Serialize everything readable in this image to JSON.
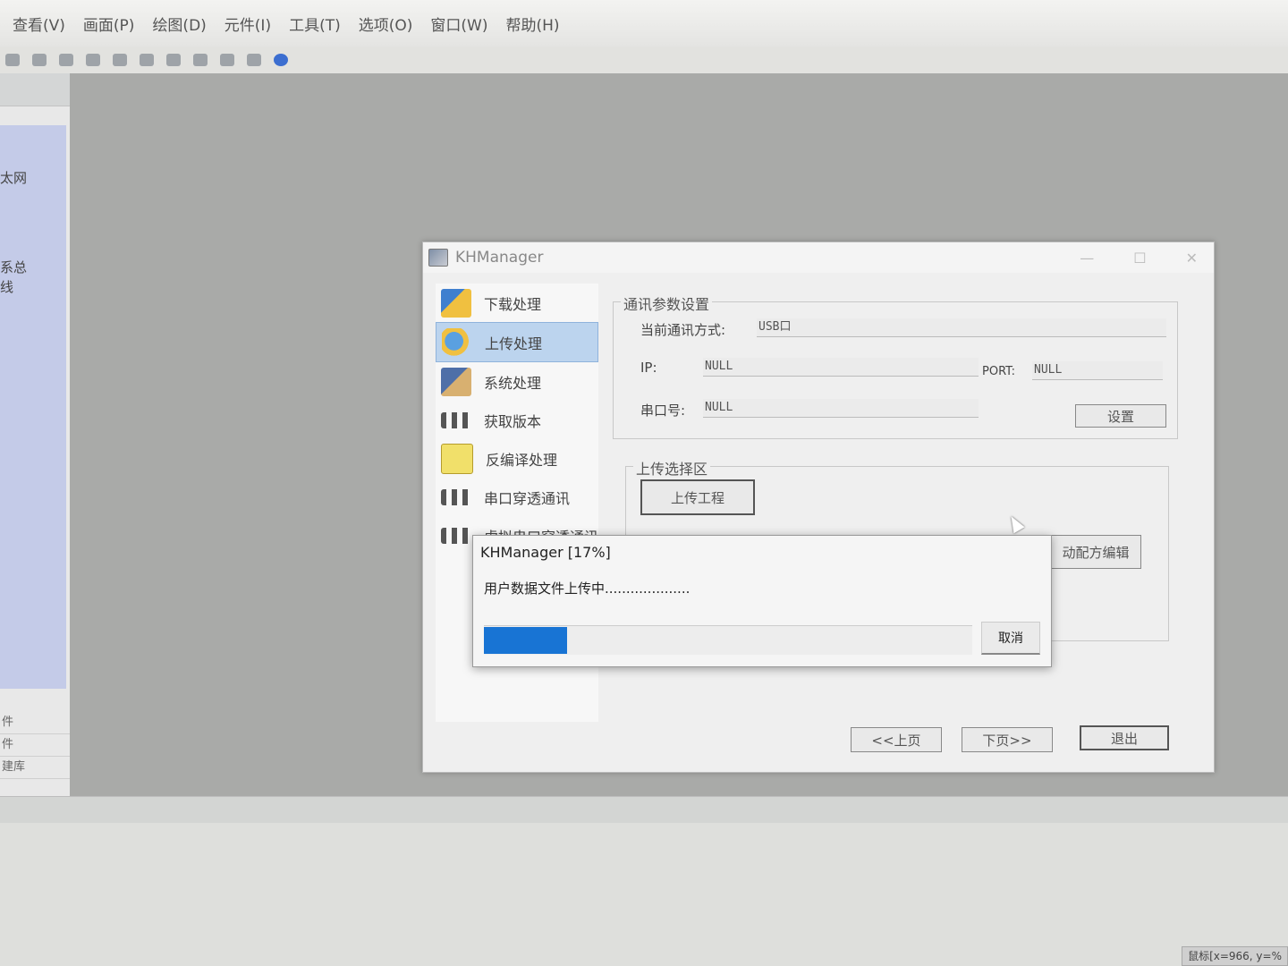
{
  "menubar": {
    "items": [
      "查看(V)",
      "画面(P)",
      "绘图(D)",
      "元件(I)",
      "工具(T)",
      "选项(O)",
      "窗口(W)",
      "帮助(H)"
    ]
  },
  "left_panel": {
    "text1": "太网",
    "text2": "系总",
    "text3": "线",
    "list": [
      "件",
      "件",
      "建库"
    ]
  },
  "status": {
    "coord": "鼠标[x=966, y=%"
  },
  "main_dialog": {
    "title": "KHManager",
    "nav": [
      {
        "label": "下载处理",
        "icon": "download-icon"
      },
      {
        "label": "上传处理",
        "icon": "upload-icon"
      },
      {
        "label": "系统处理",
        "icon": "system-icon"
      },
      {
        "label": "获取版本",
        "icon": "version-icon"
      },
      {
        "label": "反编译处理",
        "icon": "decompile-icon"
      },
      {
        "label": "串口穿透通讯",
        "icon": "serial-icon"
      },
      {
        "label": "虚拟串口穿透通讯",
        "icon": "virtual-serial-icon"
      }
    ],
    "comm": {
      "group_title": "通讯参数设置",
      "mode_label": "当前通讯方式:",
      "mode_value": "USB口",
      "ip_label": "IP:",
      "ip_value": "NULL",
      "port_label": "PORT:",
      "port_value": "NULL",
      "serial_label": "串口号:",
      "serial_value": "NULL",
      "settings_btn": "设置"
    },
    "upload": {
      "group_title": "上传选择区",
      "upload_project_btn": "上传工程",
      "recipe_btn": "动配方编辑"
    },
    "footer": {
      "prev_btn": "<<上页",
      "next_btn": "下页>>",
      "exit_btn": "退出"
    }
  },
  "progress_dialog": {
    "title": "KHManager [17%]",
    "message": "用户数据文件上传中....................",
    "progress": 0.17,
    "cancel_btn": "取消"
  },
  "colors": {
    "progress_fill": "#1874d4",
    "nav_active": "#bcd4ee"
  }
}
